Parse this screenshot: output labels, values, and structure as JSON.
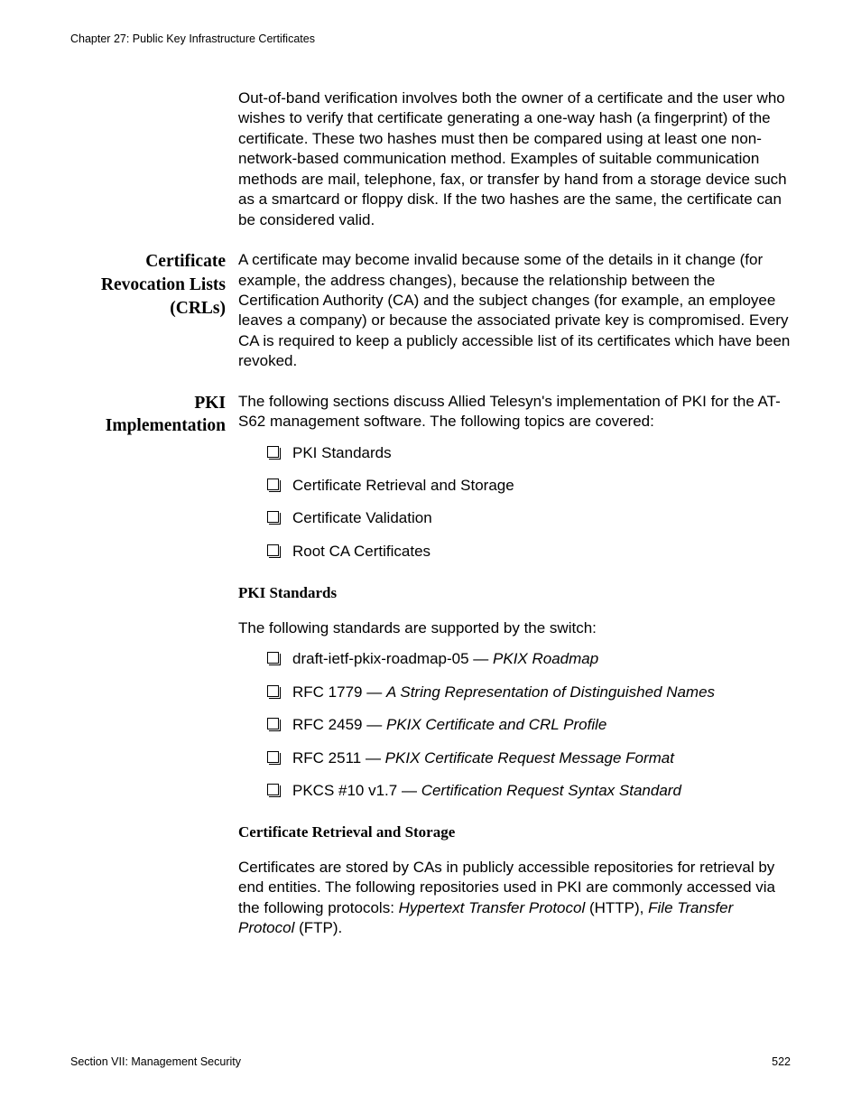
{
  "header": "Chapter 27: Public Key Infrastructure Certificates",
  "intro_para": "Out-of-band verification involves both the owner of a certificate and the user who wishes to verify that certificate generating a one-way hash (a fingerprint) of the certificate. These two hashes must then be compared using at least one non-network-based communication method. Examples of suitable communication methods are mail, telephone, fax, or transfer by hand from a storage device such as a smartcard or floppy disk. If the two hashes are the same, the certificate can be considered valid.",
  "crl": {
    "side": "Certificate Revocation Lists (CRLs)",
    "body": "A certificate may become invalid because some of the details in it change (for example, the address changes), because the relationship between the Certification Authority (CA) and the subject changes (for example, an employee leaves a company) or because the associated private key is compromised. Every CA is required to keep a publicly accessible list of its certificates which have been revoked."
  },
  "pki": {
    "side": "PKI Implementation",
    "intro": "The following sections discuss Allied Telesyn's implementation of PKI for the AT-S62 management software. The following topics are covered:",
    "topics": [
      "PKI Standards",
      "Certificate Retrieval and Storage",
      "Certificate Validation",
      "Root CA Certificates"
    ],
    "standards": {
      "heading": "PKI Standards",
      "intro": "The following standards are supported by the switch:",
      "items": [
        {
          "prefix": "draft-ietf-pkix-roadmap-05 — ",
          "title": "PKIX Roadmap"
        },
        {
          "prefix": "RFC 1779 — ",
          "title": "A String Representation of Distinguished Names"
        },
        {
          "prefix": "RFC 2459 — ",
          "title": "PKIX Certificate and CRL Profile"
        },
        {
          "prefix": "RFC 2511 — ",
          "title": "PKIX Certificate Request Message Format"
        },
        {
          "prefix": "PKCS #10 v1.7 — ",
          "title": "Certification Request Syntax Standard"
        }
      ]
    },
    "retrieval": {
      "heading": "Certificate Retrieval and Storage",
      "body_parts": [
        "Certificates are stored by CAs in publicly accessible repositories for retrieval by end entities. The following repositories used in PKI are commonly accessed via the following protocols: ",
        "Hypertext Transfer Protocol",
        " (HTTP), ",
        "File Transfer Protocol",
        " (FTP)."
      ]
    }
  },
  "footer": {
    "left": "Section VII: Management Security",
    "right": "522"
  }
}
